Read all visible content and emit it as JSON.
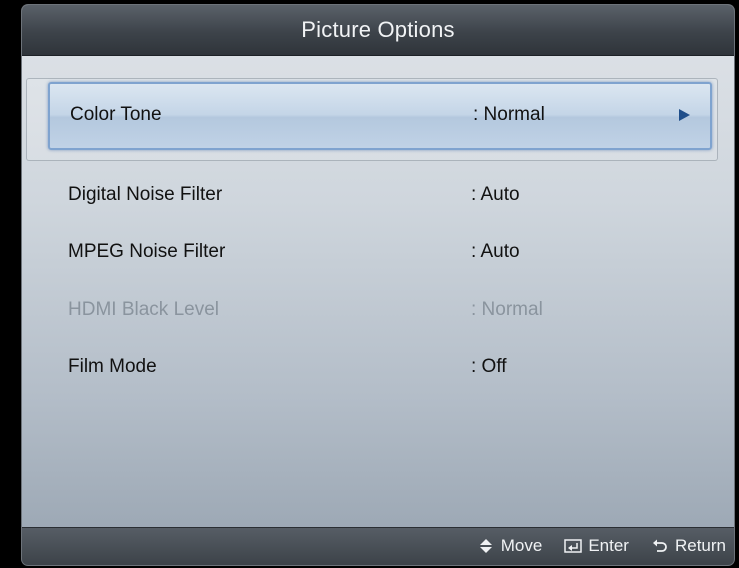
{
  "window": {
    "title": "Picture Options"
  },
  "menu": {
    "items": [
      {
        "label": "Color Tone",
        "value": ": Normal",
        "state": "selected",
        "has_submenu": true
      },
      {
        "label": "Digital Noise Filter",
        "value": ": Auto",
        "state": "normal"
      },
      {
        "label": "MPEG Noise Filter",
        "value": ": Auto",
        "state": "normal"
      },
      {
        "label": "HDMI Black Level",
        "value": ": Normal",
        "state": "disabled"
      },
      {
        "label": "Film Mode",
        "value": ": Off",
        "state": "normal"
      }
    ]
  },
  "footer": {
    "move_label": "Move",
    "enter_label": "Enter",
    "return_label": "Return",
    "icons": [
      "up-down-arrows-icon",
      "enter-icon",
      "return-icon"
    ]
  },
  "colors": {
    "title_bar": "#3d434a",
    "selection_border": "#7fa3cf",
    "arrow": "#1f4e8a",
    "disabled_text": "#8a949e"
  }
}
